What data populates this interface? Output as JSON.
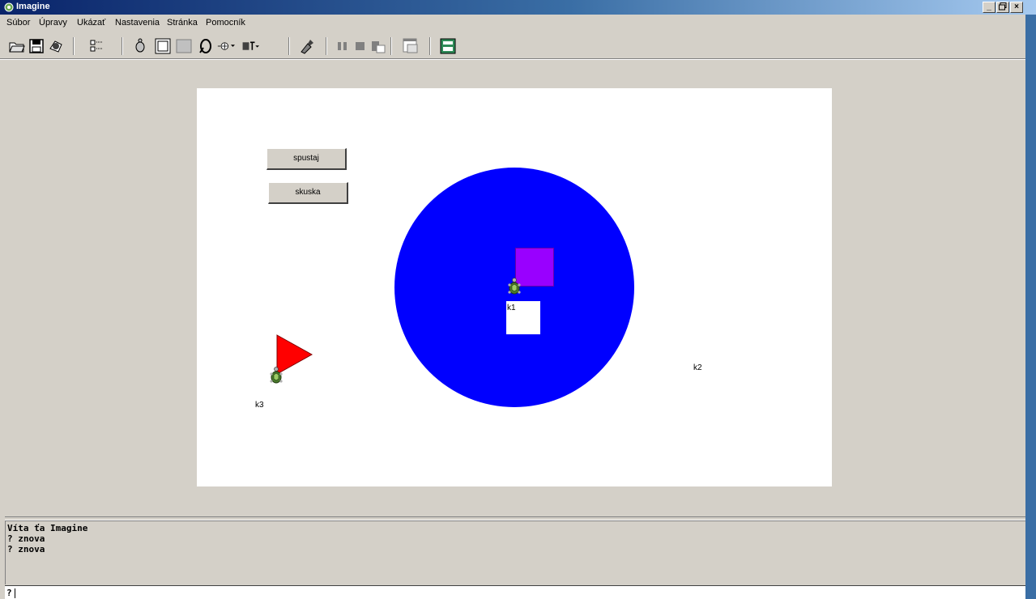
{
  "window": {
    "title": "Imagine",
    "minimize": "_",
    "restore": "▫",
    "close": "×"
  },
  "menu": [
    "Súbor",
    "Úpravy",
    "Ukázať",
    "Nastavenia",
    "Stránka",
    "Pomocník"
  ],
  "toolbar": {
    "icons": [
      "open-folder-icon",
      "save-icon",
      "print-icon",
      "grid-icon",
      "turtle-icon",
      "rectangle-icon",
      "filled-rectangle-icon",
      "lasso-icon",
      "shape-icon",
      "text-icon",
      "paint-icon",
      "pause-icon",
      "stop-icon",
      "run-icon",
      "window-icon",
      "page-icon"
    ]
  },
  "page": {
    "buttons": {
      "spustaj": "spustaj",
      "skuska": "skuska"
    },
    "labels": {
      "k1": "k1",
      "k2": "k2",
      "k3": "k3"
    },
    "colors": {
      "circle": "#0000ff",
      "square": "#9900ff",
      "triangle": "#ff0000",
      "background": "#ffffff"
    }
  },
  "console": {
    "lines": [
      "Víta ťa Imagine",
      "? znova",
      "? znova"
    ],
    "prompt": "?"
  }
}
